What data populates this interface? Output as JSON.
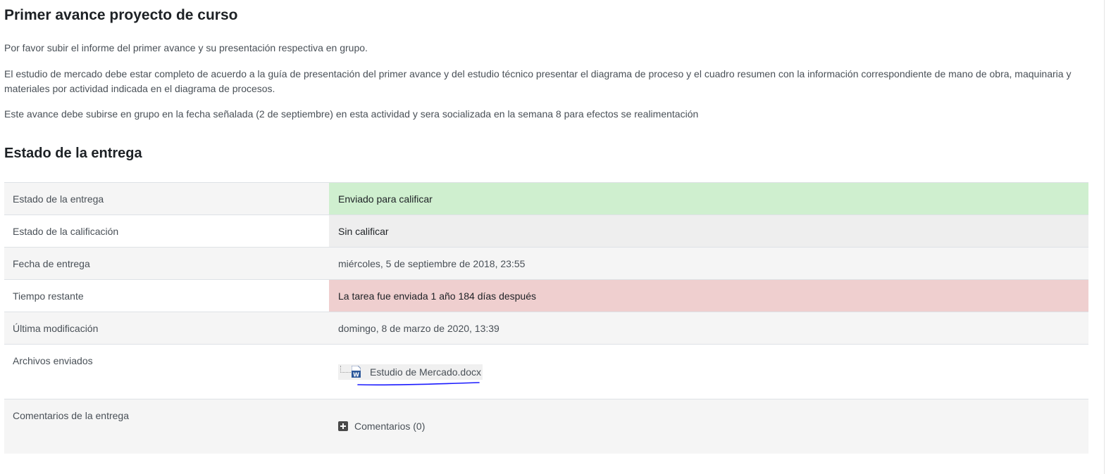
{
  "page": {
    "title": "Primer avance proyecto de curso"
  },
  "intro": {
    "p1": "Por favor subir el informe del primer avance y su presentación respectiva en grupo.",
    "p2": "El estudio de mercado debe estar completo de acuerdo a la guía de presentación del primer avance y del estudio técnico presentar el diagrama de proceso y el cuadro resumen con la información correspondiente de mano de obra, maquinaria y materiales por actividad indicada en el diagrama de procesos.",
    "p3": "Este avance debe subirse en grupo en la fecha señalada (2 de septiembre) en esta actividad y sera socializada en la semana 8 para efectos se realimentación"
  },
  "status": {
    "heading": "Estado de la entrega",
    "rows": [
      {
        "label": "Estado de la entrega",
        "value": "Enviado para calificar",
        "state_color": "#cfefcf"
      },
      {
        "label": "Estado de la calificación",
        "value": "Sin calificar",
        "state_color": "#eeeeee"
      },
      {
        "label": "Fecha de entrega",
        "value": "miércoles, 5 de septiembre de 2018, 23:55"
      },
      {
        "label": "Tiempo restante",
        "value": "La tarea fue enviada 1 año 184 días después",
        "state_color": "#efcfcf"
      },
      {
        "label": "Última modificación",
        "value": "domingo, 8 de marzo de 2020, 13:39"
      },
      {
        "label": "Archivos enviados",
        "file": {
          "name": "Estudio de Mercado.docx",
          "icon": "word-document-icon"
        }
      },
      {
        "label": "Comentarios de la entrega",
        "comments": {
          "link": "Comentarios (0)",
          "icon": "plus-square-icon"
        }
      }
    ]
  },
  "colors": {
    "heading": "#1d2125",
    "body_text": "#495057",
    "underline_annotation": "#1a1aff"
  }
}
